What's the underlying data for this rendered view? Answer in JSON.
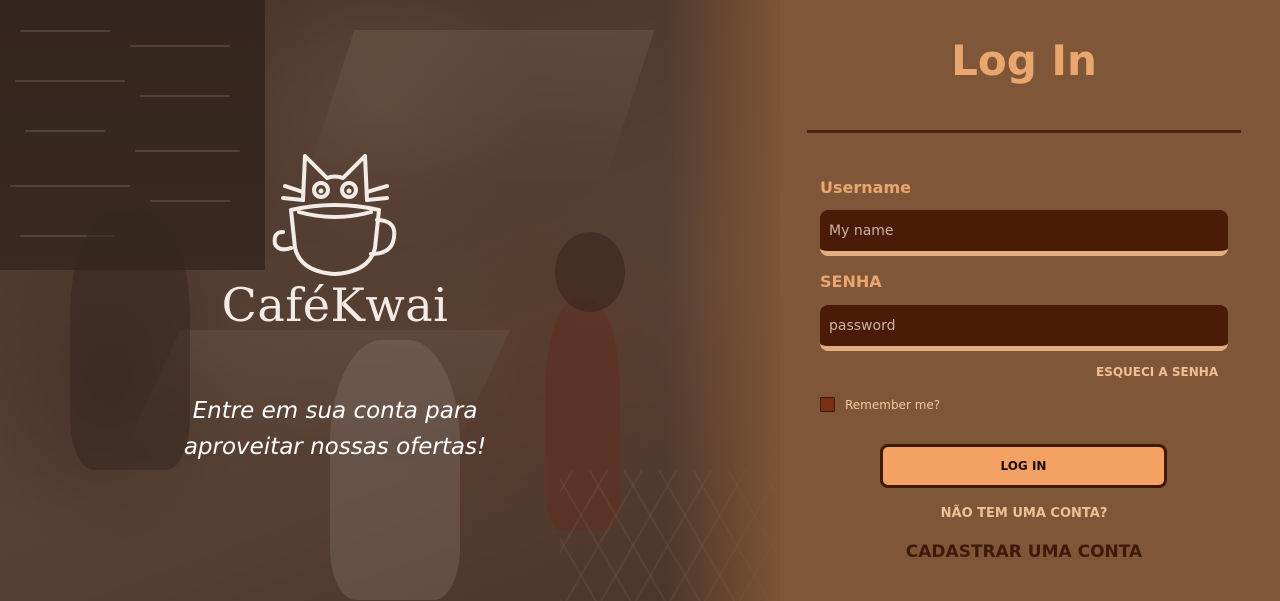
{
  "hero": {
    "brand_name": "CaféKwai",
    "tagline_line1": "Entre em sua conta para",
    "tagline_line2": "aproveitar nossas ofertas!",
    "logo_icon": "cat-coffee-cup-icon"
  },
  "login": {
    "title": "Log In",
    "username_label": "Username",
    "username_placeholder": "My name",
    "password_label": "SENHA",
    "password_placeholder": "password",
    "forgot_password": "ESQUECI A SENHA",
    "remember_me": "Remember me?",
    "submit_label": "LOG IN",
    "no_account": "NÃO TEM UMA CONTA?",
    "register_link": "CADASTRAR UMA CONTA"
  },
  "colors": {
    "panel_bg": "#805638",
    "accent": "#e9a66e",
    "button": "#f4a263",
    "input_bg": "#4a1c08",
    "dark_text": "#3e1a0b"
  }
}
